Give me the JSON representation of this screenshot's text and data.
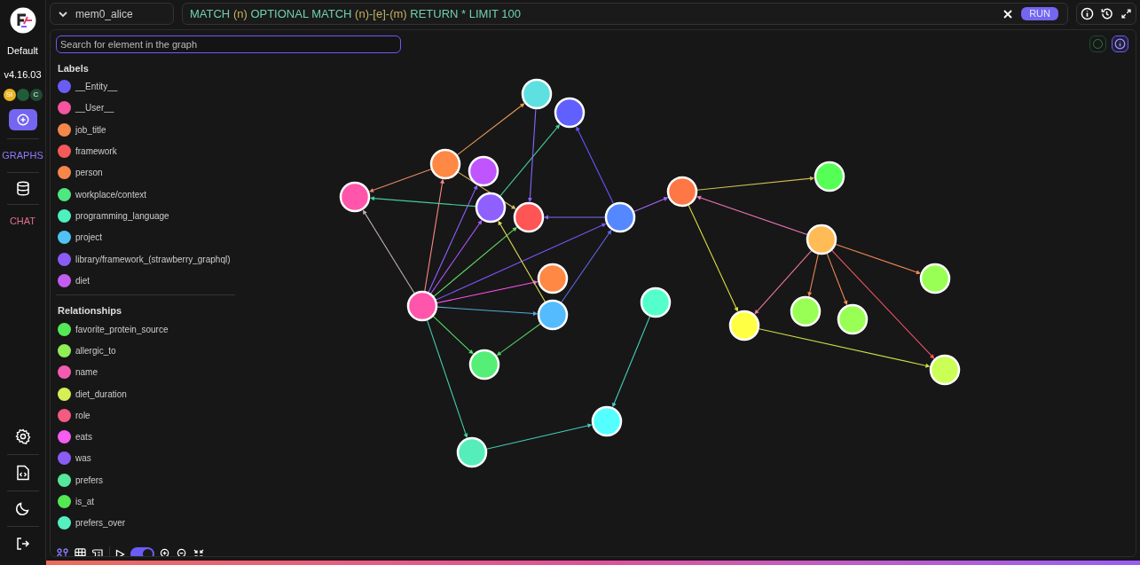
{
  "sidebar": {
    "workspace": "Default",
    "version": "v4.16.03",
    "badges": [
      {
        "text": "SI",
        "color": "#e8b420"
      },
      {
        "color": "#1f5c3a"
      },
      {
        "text": "C",
        "color": "#1f4a33"
      }
    ],
    "nav": [
      {
        "kind": "button"
      },
      {
        "kind": "text",
        "label": "GRAPHS",
        "selected": true
      },
      {
        "kind": "database"
      },
      {
        "kind": "text",
        "label": "CHAT",
        "selected": false
      }
    ],
    "bottom": [
      {
        "kind": "settings"
      },
      {
        "kind": "code"
      },
      {
        "kind": "theme"
      },
      {
        "kind": "logout"
      }
    ]
  },
  "graph_select": {
    "value": "mem0_alice"
  },
  "query": {
    "parts": [
      {
        "text": "MATCH ",
        "kind": "keyword"
      },
      {
        "text": "(n)",
        "kind": "var"
      },
      {
        "text": " OPTIONAL MATCH ",
        "kind": "keyword"
      },
      {
        "text": "(n)",
        "kind": "var"
      },
      {
        "text": "-",
        "kind": "keyword"
      },
      {
        "text": "[e]",
        "kind": "var"
      },
      {
        "text": "-",
        "kind": "keyword"
      },
      {
        "text": "(m)",
        "kind": "var"
      },
      {
        "text": " RETURN * LIMIT 100",
        "kind": "keyword"
      }
    ],
    "run": "RUN"
  },
  "search": {
    "placeholder": "Search for element in the graph"
  },
  "labels": {
    "title": "Labels",
    "items": [
      {
        "name": "__Entity__",
        "color": "#6b5cf6"
      },
      {
        "name": "__User__",
        "color": "#f5559e"
      },
      {
        "name": "job_title",
        "color": "#f6874a"
      },
      {
        "name": "framework",
        "color": "#f55a5a"
      },
      {
        "name": "person",
        "color": "#f6874a"
      },
      {
        "name": "workplace/context",
        "color": "#4de87f"
      },
      {
        "name": "programming_language",
        "color": "#4ef0c0"
      },
      {
        "name": "project",
        "color": "#4fc3f5"
      },
      {
        "name": "library/framework_(strawberry_graphql)",
        "color": "#8a5cf6"
      },
      {
        "name": "diet",
        "color": "#c55cf0"
      }
    ]
  },
  "relationships": {
    "title": "Relationships",
    "items": [
      {
        "name": "favorite_protein_source",
        "color": "#55e855"
      },
      {
        "name": "allergic_to",
        "color": "#8ef055"
      },
      {
        "name": "name",
        "color": "#f55cb0"
      },
      {
        "name": "diet_duration",
        "color": "#d4f055"
      },
      {
        "name": "role",
        "color": "#f55a80"
      },
      {
        "name": "eats",
        "color": "#f55cf0"
      },
      {
        "name": "was",
        "color": "#8a5cf6"
      },
      {
        "name": "prefers",
        "color": "#55e89a"
      },
      {
        "name": "is_at",
        "color": "#55e855"
      },
      {
        "name": "prefers_over",
        "color": "#55f0c0"
      }
    ]
  },
  "toolbar": {
    "animation_on": true
  },
  "graph": {
    "nodes": [
      {
        "color": "#5ee0e0"
      },
      {
        "color": "#6060ff"
      },
      {
        "color": "#ff8844"
      },
      {
        "color": "#c055ff"
      },
      {
        "color": "#ff55aa"
      },
      {
        "color": "#9060ff"
      },
      {
        "color": "#ff5555"
      },
      {
        "color": "#5588ff"
      },
      {
        "color": "#ff7744"
      },
      {
        "color": "#55ff55"
      },
      {
        "color": "#ffbb55"
      },
      {
        "color": "#99ff55"
      },
      {
        "color": "#ff55aa"
      },
      {
        "color": "#ff8844"
      },
      {
        "color": "#55bbff"
      },
      {
        "color": "#55ffcc"
      },
      {
        "color": "#ffff44"
      },
      {
        "color": "#99ff55"
      },
      {
        "color": "#99ff55"
      },
      {
        "color": "#ccff55"
      },
      {
        "color": "#55ee77"
      },
      {
        "color": "#55ffff"
      },
      {
        "color": "#55eebb"
      }
    ]
  }
}
